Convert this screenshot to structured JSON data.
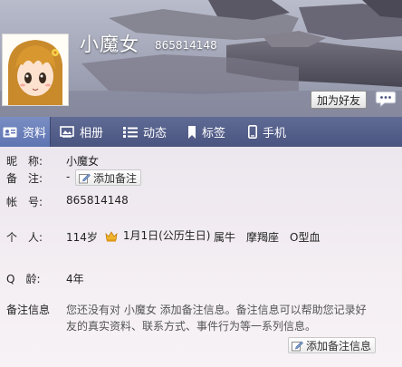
{
  "profile": {
    "nickname": "小魔女",
    "qq_number": "865814148",
    "add_friend_label": "加为好友"
  },
  "tabs": [
    {
      "label": "资料",
      "icon": "profile-card-icon",
      "active": true
    },
    {
      "label": "相册",
      "icon": "photo-album-icon",
      "active": false
    },
    {
      "label": "动态",
      "icon": "feed-list-icon",
      "active": false
    },
    {
      "label": "标签",
      "icon": "bookmark-tag-icon",
      "active": false
    },
    {
      "label": "手机",
      "icon": "mobile-phone-icon",
      "active": false
    }
  ],
  "details": {
    "nickname_label": "昵　称:",
    "nickname_value": "小魔女",
    "remark_label": "备　注:",
    "remark_value": "-",
    "remark_button": "添加备注",
    "account_label": "帐　号:",
    "account_value": "865814148",
    "personal_label": "个　人:",
    "age": "114岁",
    "birthday": "1月1日(公历生日)",
    "zodiac": "属牛",
    "constellation": "摩羯座",
    "blood_type": "O型血",
    "q_age_label": "Q　龄:",
    "q_age_value": "4年",
    "remark_info_label": "备注信息",
    "remark_info_line1": "您还没有对 小魔女 添加备注信息。备注信息可以帮助您记录好",
    "remark_info_line2": "友的真实资料、联系方式、事件行为等一系列信息。",
    "remark_info_button": "添加备注信息"
  },
  "colors": {
    "tab_bar": "#4f5a86",
    "tab_active": "#6e82bd",
    "crown": "#e8a31b"
  }
}
